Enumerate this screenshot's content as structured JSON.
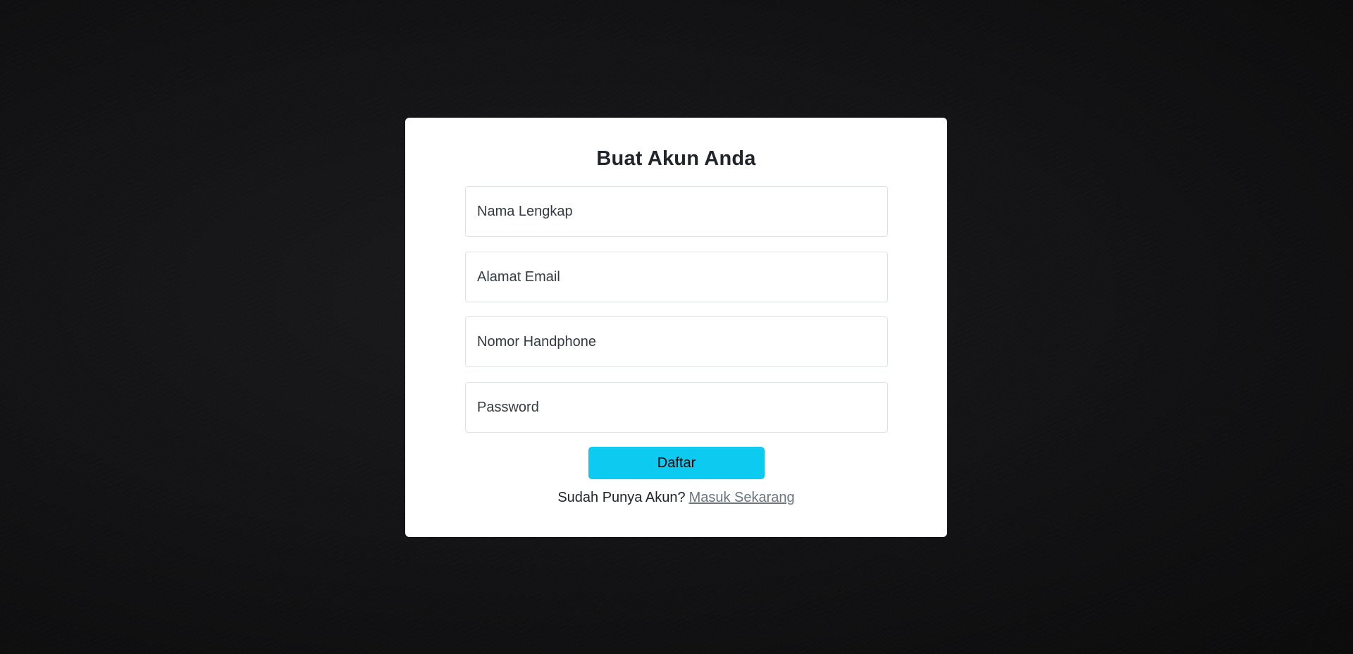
{
  "page": {
    "background_color": "#121214"
  },
  "form": {
    "title": "Buat Akun Anda",
    "fields": [
      {
        "name": "nama",
        "placeholder": "Nama Lengkap",
        "value": ""
      },
      {
        "name": "email",
        "placeholder": "Alamat Email",
        "value": ""
      },
      {
        "name": "handphone",
        "placeholder": "Nomor Handphone",
        "value": ""
      },
      {
        "name": "password",
        "placeholder": "Password",
        "value": ""
      }
    ],
    "submit_label": "Daftar",
    "submit_color": "#0dcaf0",
    "footer_text": "Sudah Punya Akun?",
    "login_link_label": "Masuk Sekarang"
  }
}
